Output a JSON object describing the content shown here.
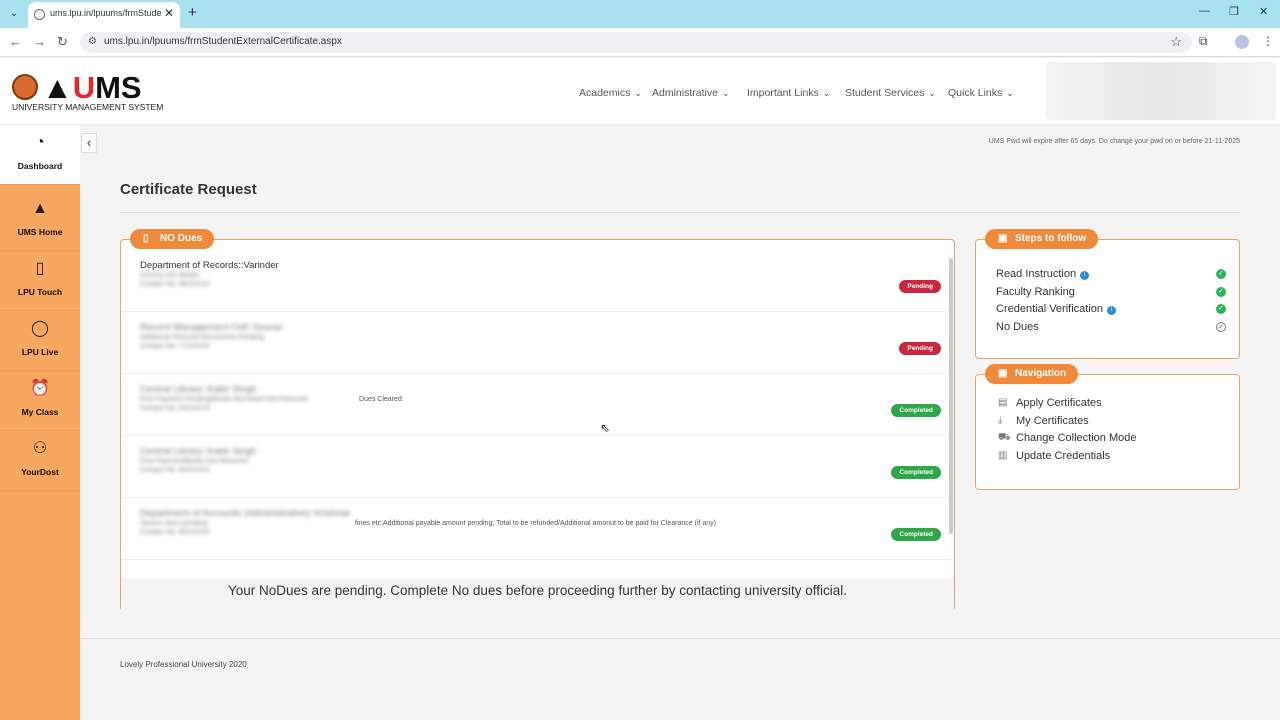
{
  "browser": {
    "tab_title": "ums.lpu.in/lpuums/frmStudentE",
    "url": "ums.lpu.in/lpuums/frmStudentExternalCertificate.aspx",
    "new_tab": "+",
    "close_tab": "✕"
  },
  "header": {
    "logo_word_pre": "",
    "logo_word_u": "U",
    "logo_word_post": "MS",
    "logo_subtitle": "UNIVERSITY MANAGEMENT SYSTEM",
    "menu": [
      "Academics",
      "Administrative",
      "Important Links",
      "Student Services",
      "Quick Links"
    ]
  },
  "sidebar": {
    "items": [
      {
        "label": "Dashboard",
        "icon": "dashboard-icon",
        "glyph": "◔"
      },
      {
        "label": "UMS Home",
        "icon": "ums-home-icon",
        "glyph": "▲"
      },
      {
        "label": "LPU Touch",
        "icon": "phone-icon",
        "glyph": "▯"
      },
      {
        "label": "LPU Live",
        "icon": "chat-icon",
        "glyph": "◯"
      },
      {
        "label": "My Class",
        "icon": "alarm-clock-icon",
        "glyph": "⏰"
      },
      {
        "label": "YourDost",
        "icon": "people-icon",
        "glyph": "⚇"
      }
    ]
  },
  "main": {
    "pwd_note": "UMS Pwd will expire after 65 days. Do change your pwd on or before 21-11-2025",
    "page_title": "Certificate Request",
    "dues": {
      "pill_label": "NO Dues",
      "rows": [
        {
          "dept": "Department of Records::Varinder",
          "line2": "Dummy line details",
          "line3": "Contact No: 98XXXXX",
          "remark": "",
          "status": "Pending",
          "blur_dept": false
        },
        {
          "dept": "Record Management Cell::Sourav",
          "line2": "Additional Records Documents Pending",
          "line3": "Contact No: 77XXXXX",
          "remark": "",
          "status": "Pending",
          "blur_dept": true
        },
        {
          "dept": "Central Library::Kabir Singh",
          "line2": "Fine Payment Pending/Books Borrowed Not Returned",
          "line3": "Contact No: 84XXXXX",
          "remark": "Dues Cleared:",
          "status": "Completed",
          "blur_dept": true
        },
        {
          "dept": "Central Library::Kabir Singh",
          "line2": "Fine Payment/Books Not Returned",
          "line3": "Contact No: 84XXXXX",
          "remark": "",
          "status": "Completed",
          "blur_dept": true
        },
        {
          "dept": "Department of Accounts (Administrative)::Krishnal",
          "line2": "Various dues pending",
          "line3": "Contact No: 85XXXXX",
          "remark": "fines etc,Additional payable amount pending, Total to be refunded/Additional amonut to be paid for Clearance (if any)",
          "status": "Completed",
          "blur_dept": true
        }
      ],
      "footer_message": "Your NoDues are pending. Complete No dues before proceeding further by contacting university official."
    },
    "steps": {
      "pill_label": "Steps to follow",
      "items": [
        {
          "label": "Read Instruction",
          "info": true,
          "done": true
        },
        {
          "label": "Faculty Ranking",
          "info": false,
          "done": true
        },
        {
          "label": "Credential Verification",
          "info": true,
          "done": true
        },
        {
          "label": "No Dues",
          "info": false,
          "done": false
        }
      ]
    },
    "navigation": {
      "pill_label": "Navigation",
      "items": [
        {
          "label": "Apply Certificates",
          "icon": "document-icon"
        },
        {
          "label": "My Certificates",
          "icon": "download-icon"
        },
        {
          "label": "Change Collection Mode",
          "icon": "delivery-icon"
        },
        {
          "label": "Update Credentials",
          "icon": "id-card-icon"
        }
      ]
    }
  },
  "footer": {
    "text": "Lovely Professional University 2020"
  },
  "colors": {
    "sidebar": "#f7a760",
    "accent": "#ef8a3a",
    "pending": "#c8283e",
    "completed": "#2fa64a"
  }
}
